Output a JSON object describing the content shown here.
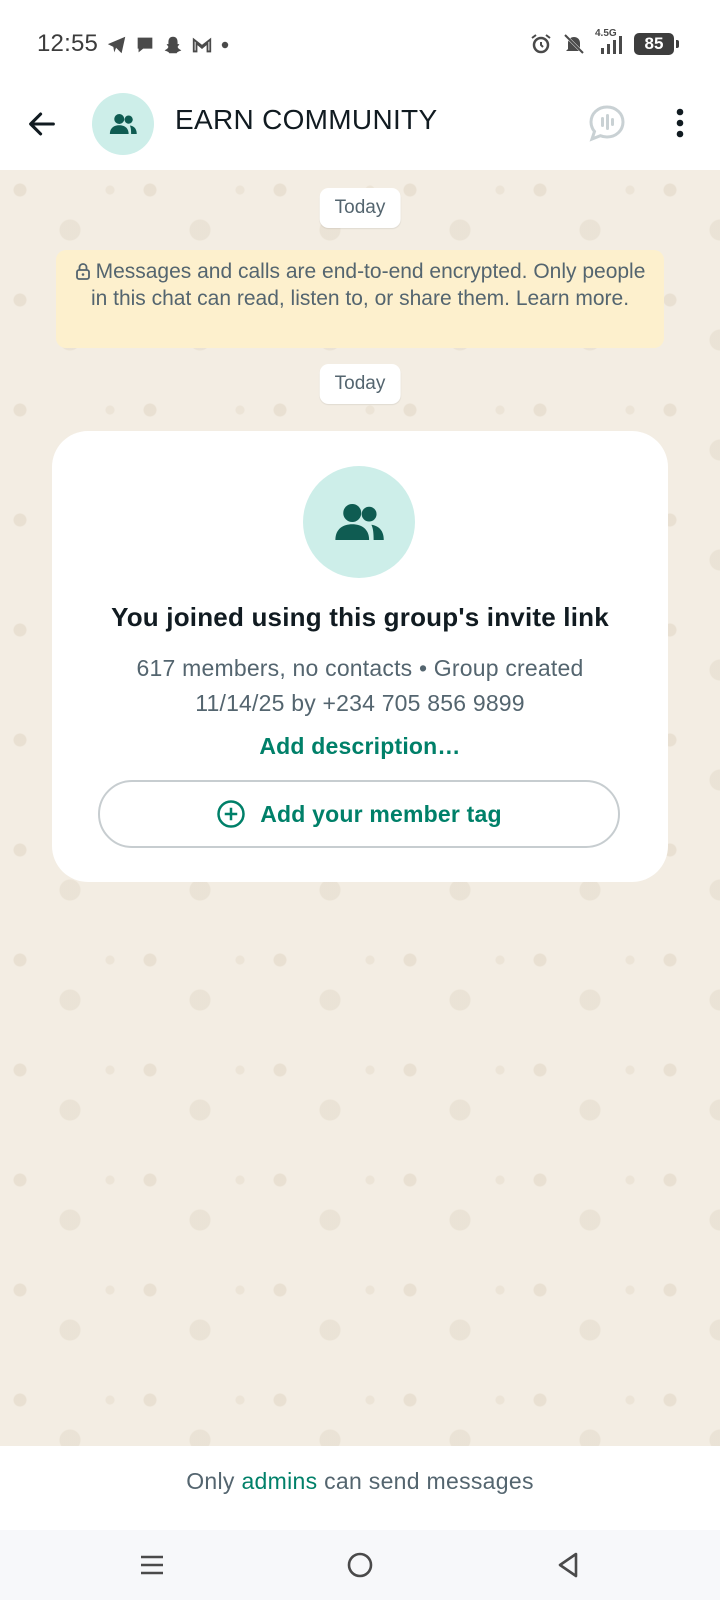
{
  "status_bar": {
    "time": "12:55",
    "left_icons": [
      "telegram-icon",
      "chat-bubble-icon",
      "snapchat-icon",
      "gmail-icon",
      "dot-icon"
    ],
    "right_icons": [
      "alarm-icon",
      "mute-icon",
      "signal-icon"
    ],
    "network_label": "4.5G",
    "battery": "85"
  },
  "header": {
    "title": "EARN COMMUNITY",
    "back_icon": "arrow-left-icon",
    "voice_chat_icon": "voice-chat-icon",
    "menu_icon": "more-vert-icon"
  },
  "chat": {
    "date_chip_1": "Today",
    "encryption_notice": "Messages and calls are end-to-end encrypted. Only people in this chat can read, listen to, or share them. Learn more.",
    "date_chip_2": "Today",
    "system_card": {
      "title": "You joined using this group's invite link",
      "info_line_1": "617 members, no contacts • Group created",
      "info_line_2": "11/14/25 by +234 705 856 9899",
      "add_description": "Add description…",
      "member_tag_button": "Add your member tag"
    }
  },
  "footer": {
    "prefix": "Only",
    "link": "admins",
    "suffix": "can send messages"
  },
  "nav_bar": {
    "icons": [
      "recents-icon",
      "home-icon",
      "back-icon"
    ]
  },
  "colors": {
    "accent": "#008069",
    "chat_background": "#f3ede3",
    "encryption_banner": "#fdf0cd",
    "avatar_background": "#cdeee9"
  }
}
